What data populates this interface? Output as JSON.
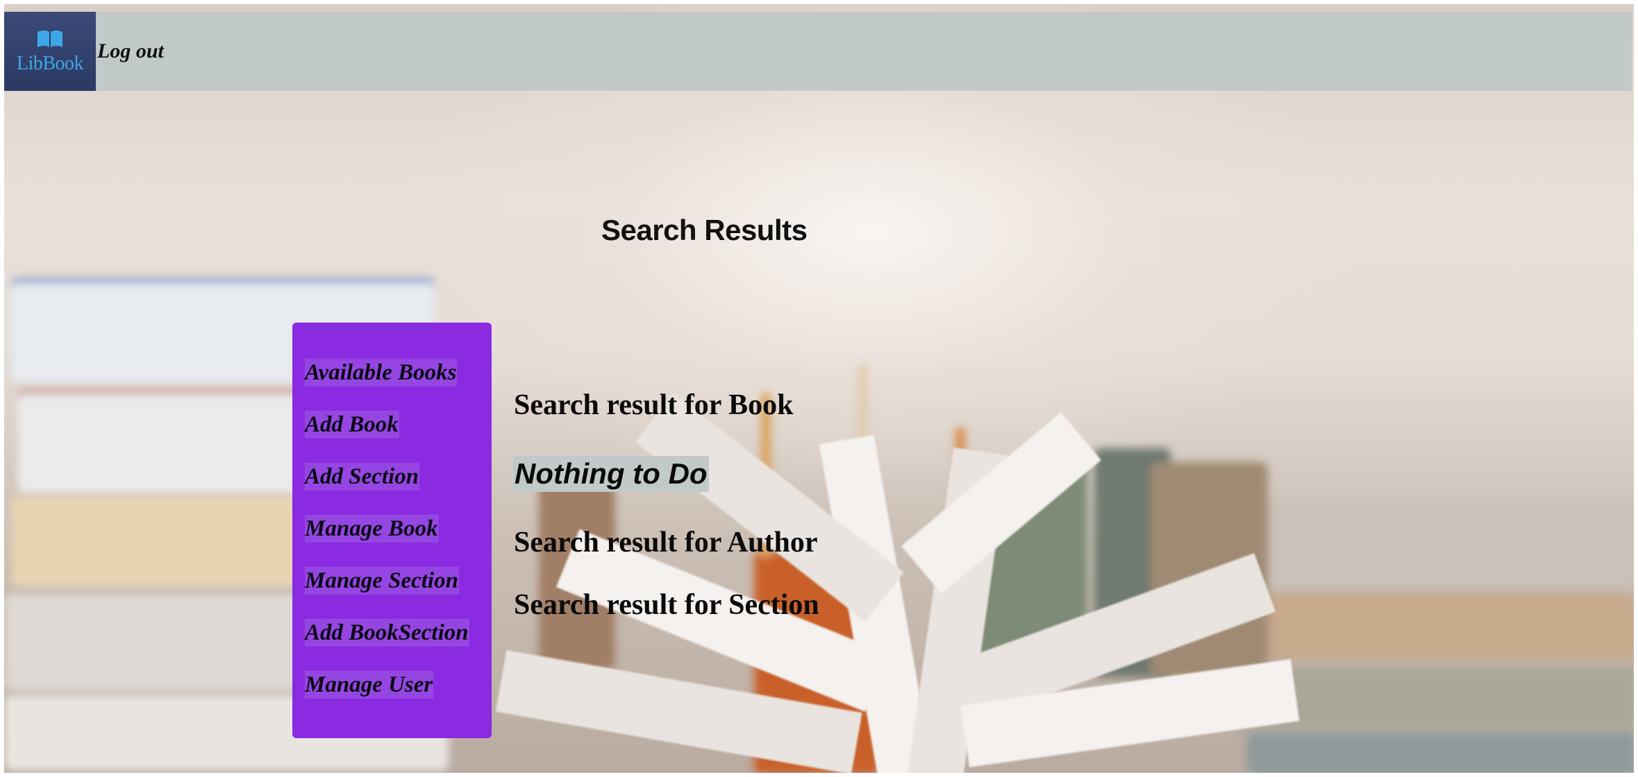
{
  "header": {
    "logo_text": "LibBook",
    "logout_label": "Log out"
  },
  "main": {
    "title": "Search Results",
    "results": {
      "book_heading": "Search result for Book",
      "book_empty_message": "Nothing to Do",
      "author_heading": "Search result for Author",
      "section_heading": "Search result for Section"
    }
  },
  "sidebar": {
    "items": [
      {
        "label": "Available Books"
      },
      {
        "label": "Add Book"
      },
      {
        "label": "Add Section"
      },
      {
        "label": "Manage Book"
      },
      {
        "label": "Manage Section"
      },
      {
        "label": "Add BookSection"
      },
      {
        "label": "Manage User"
      }
    ]
  },
  "colors": {
    "header_bar": "#c2cac9",
    "logo_bg": "#2b3a63",
    "logo_text": "#3fa7e8",
    "sidebar_bg": "#8a2be2",
    "highlight_bg": "#c2cac9"
  },
  "icons": {
    "logo_icon": "open-book-icon"
  }
}
